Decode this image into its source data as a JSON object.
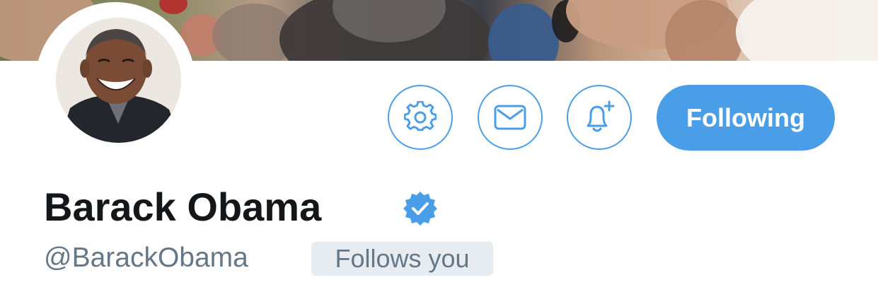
{
  "profile": {
    "display_name": "Barack Obama",
    "handle": "@BarackObama",
    "follows_you_badge": "Follows you",
    "verified": true
  },
  "actions": {
    "settings_icon": "gear-icon",
    "message_icon": "envelope-icon",
    "notify_icon": "bell-plus-icon",
    "follow_label": "Following"
  },
  "colors": {
    "accent": "#4a9ee8",
    "name_text": "#14171a",
    "secondary_text": "#657786",
    "badge_bg": "#e6ecf0",
    "verified": "#4a9ee8"
  }
}
